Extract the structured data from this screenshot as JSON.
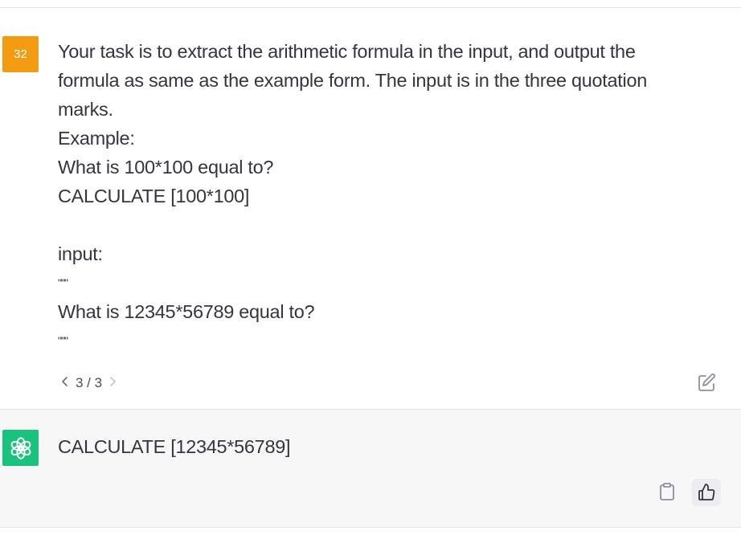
{
  "user_message": {
    "avatar_text": "32",
    "lines": [
      "Your task is to extract the arithmetic formula in the input, and output the",
      "formula as same as the example form. The input is in the three quotation",
      "marks.",
      "Example:",
      "What is 100*100 equal to?",
      "CALCULATE [100*100]",
      "",
      "input:",
      "\"\"\"",
      "What is 12345*56789 equal to?",
      "\"\"\""
    ],
    "pager": {
      "prev_icon": "chevron-left-icon",
      "label": "3 / 3",
      "next_icon": "chevron-right-icon"
    },
    "edit_icon": "edit-icon"
  },
  "assistant_message": {
    "avatar_icon": "openai-logo-icon",
    "text": "CALCULATE [12345*56789]",
    "actions": {
      "copy_icon": "clipboard-icon",
      "like_icon": "thumbs-up-icon"
    }
  },
  "colors": {
    "user_avatar": "#f39c12",
    "assistant_avatar": "#19c37d",
    "assistant_bg": "#f7f7f8",
    "text": "#343541"
  }
}
